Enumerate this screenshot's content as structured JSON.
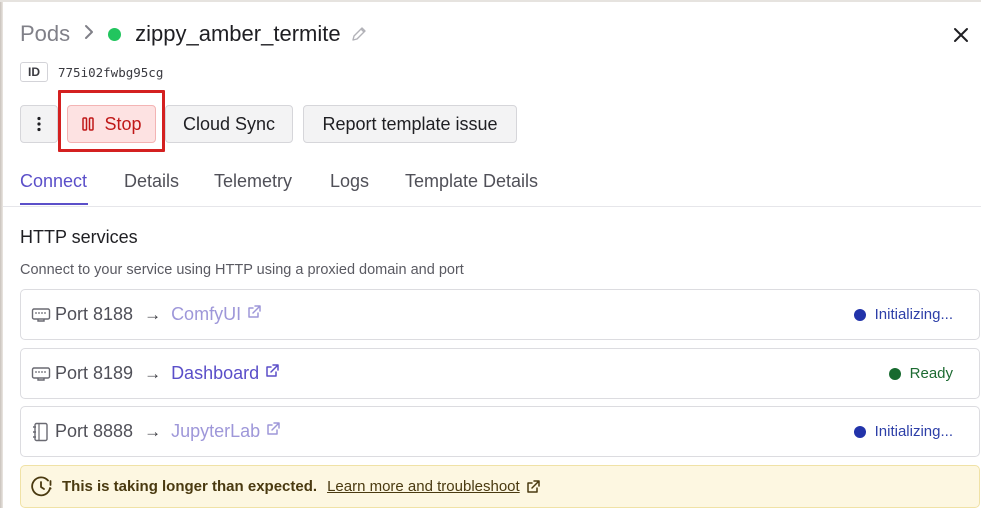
{
  "header": {
    "breadcrumb_root": "Pods",
    "breadcrumb_sep": "›",
    "pod_name": "zippy_amber_termite",
    "status_color": "#22c55e"
  },
  "id": {
    "label": "ID",
    "value": "775i02fwbg95cg"
  },
  "actions": {
    "more_label": "⋮",
    "stop_label": "Stop",
    "cloud_sync_label": "Cloud Sync",
    "report_label": "Report template issue"
  },
  "tabs": [
    {
      "label": "Connect",
      "active": true
    },
    {
      "label": "Details",
      "active": false
    },
    {
      "label": "Telemetry",
      "active": false
    },
    {
      "label": "Logs",
      "active": false
    },
    {
      "label": "Template Details",
      "active": false
    }
  ],
  "http": {
    "title": "HTTP services",
    "description": "Connect to your service using HTTP using a proxied domain and port",
    "services": [
      {
        "port": "Port 8188",
        "arrow": "→",
        "name": "ComfyUI",
        "status": "Initializing...",
        "icon": "ethernet-port-icon"
      },
      {
        "port": "Port 8189",
        "arrow": "→",
        "name": "Dashboard",
        "status": "Ready",
        "icon": "ethernet-port-icon"
      },
      {
        "port": "Port 8888",
        "arrow": "→",
        "name": "JupyterLab",
        "status": "Initializing...",
        "icon": "notebook-icon"
      }
    ]
  },
  "warning": {
    "text": "This is taking longer than expected.",
    "link": "Learn more and troubleshoot",
    "icon": "clock-alert-icon"
  },
  "colors": {
    "accent": "#5b4fc9",
    "stop_bg": "#fde2e2",
    "stop_text": "#c01818",
    "initializing": "#2233aa",
    "ready": "#176a2f",
    "warning_bg": "#fdf7e1"
  }
}
